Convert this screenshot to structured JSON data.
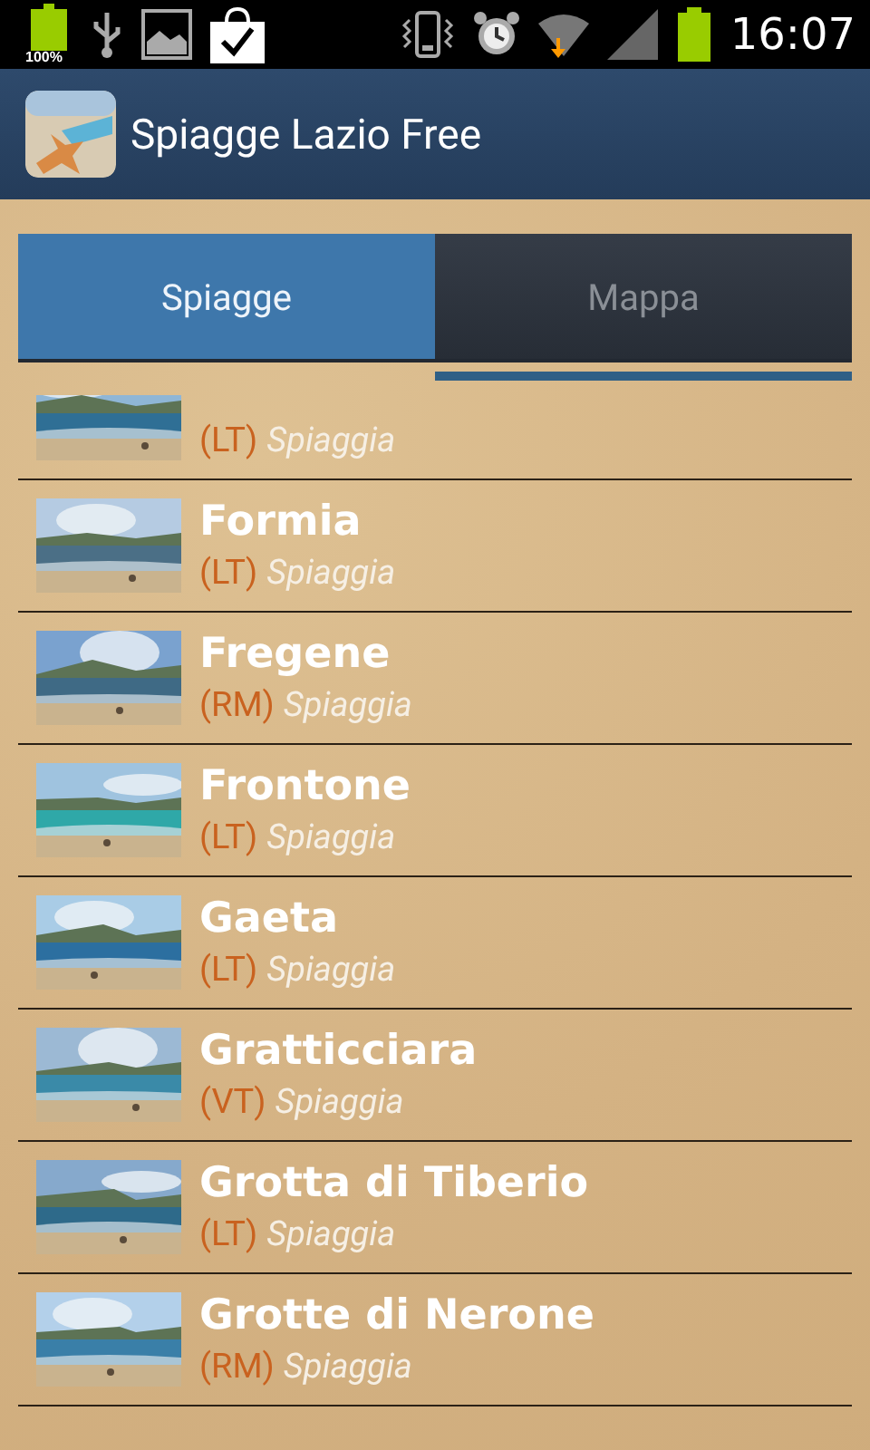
{
  "status_bar": {
    "battery_label": "100%",
    "time": "16:07"
  },
  "action_bar": {
    "title": "Spiagge Lazio Free"
  },
  "tabs": [
    {
      "label": "Spiagge",
      "selected": true,
      "underlined": false
    },
    {
      "label": "Mappa",
      "selected": false,
      "underlined": true
    }
  ],
  "beaches": [
    {
      "province": "(LT)",
      "type": "Spiaggia"
    },
    {
      "name": "Formia",
      "province": "(LT)",
      "type": "Spiaggia"
    },
    {
      "name": "Fregene",
      "province": "(RM)",
      "type": "Spiaggia"
    },
    {
      "name": "Frontone",
      "province": "(LT)",
      "type": "Spiaggia"
    },
    {
      "name": "Gaeta",
      "province": "(LT)",
      "type": "Spiaggia"
    },
    {
      "name": "Gratticciara",
      "province": "(VT)",
      "type": "Spiaggia"
    },
    {
      "name": "Grotta di Tiberio",
      "province": "(LT)",
      "type": "Spiaggia"
    },
    {
      "name": "Grotte di Nerone",
      "province": "(RM)",
      "type": "Spiaggia"
    }
  ]
}
